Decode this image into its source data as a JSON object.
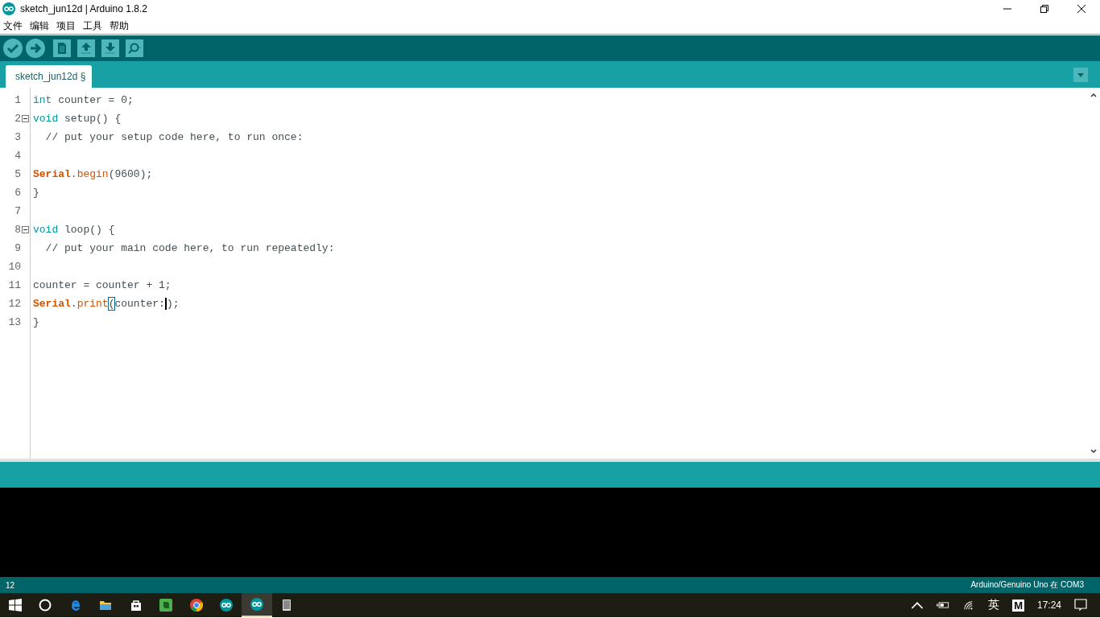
{
  "window": {
    "title": "sketch_jun12d | Arduino 1.8.2"
  },
  "menu": [
    "文件",
    "编辑",
    "项目",
    "工具",
    "帮助"
  ],
  "toolbar": [
    {
      "kind": "verify"
    },
    {
      "kind": "upload"
    },
    {
      "kind": "new"
    },
    {
      "kind": "open"
    },
    {
      "kind": "save"
    }
  ],
  "tabs": [
    {
      "label": "sketch_jun12d §",
      "selected": true
    }
  ],
  "editor": {
    "lines": [
      {
        "number": "1",
        "tokens": [
          {
            "kind": "type",
            "text": "int"
          },
          {
            "kind": "plain",
            "text": " counter = 0;"
          }
        ]
      },
      {
        "number": "2",
        "fold": true,
        "tokens": [
          {
            "kind": "type",
            "text": "void"
          },
          {
            "kind": "plain",
            "text": " setup() {"
          }
        ]
      },
      {
        "number": "3",
        "tokens": [
          {
            "kind": "comment",
            "text": "  // put your setup code here, to run once:"
          }
        ]
      },
      {
        "number": "4"
      },
      {
        "number": "5",
        "tokens": [
          {
            "kind": "class",
            "text": "Serial"
          },
          {
            "kind": "plain",
            "text": "."
          },
          {
            "kind": "func",
            "text": "begin"
          },
          {
            "kind": "plain",
            "text": "(9600);"
          }
        ]
      },
      {
        "number": "6",
        "tokens": [
          {
            "kind": "plain",
            "text": "}"
          }
        ]
      },
      {
        "number": "7"
      },
      {
        "number": "8",
        "fold": true,
        "tokens": [
          {
            "kind": "type",
            "text": "void"
          },
          {
            "kind": "plain",
            "text": " loop() {"
          }
        ]
      },
      {
        "number": "9",
        "tokens": [
          {
            "kind": "comment",
            "text": "  // put your main code here, to run repeatedly:"
          }
        ]
      },
      {
        "number": "10"
      },
      {
        "number": "11",
        "tokens": [
          {
            "kind": "plain",
            "text": "counter = counter + 1;"
          }
        ]
      },
      {
        "number": "12",
        "tokens": [
          {
            "kind": "class",
            "text": "Serial"
          },
          {
            "kind": "plain",
            "text": "."
          },
          {
            "kind": "func",
            "text": "print"
          },
          {
            "kind": "bracket",
            "text": "("
          },
          {
            "kind": "plain",
            "text": "counter:"
          },
          {
            "kind": "cursor",
            "text": ")"
          },
          {
            "kind": "plain",
            "text": ";"
          }
        ]
      },
      {
        "number": "13",
        "tokens": [
          {
            "kind": "plain",
            "text": "}"
          }
        ]
      }
    ]
  },
  "status_bar": {
    "line": "12",
    "board": "Arduino/Genuino Uno 在 COM3"
  },
  "taskbar": {
    "apps": [
      {
        "kind": "start",
        "selected": false
      },
      {
        "kind": "search",
        "selected": false
      },
      {
        "kind": "browser",
        "selected": false
      },
      {
        "kind": "folder",
        "selected": false
      },
      {
        "kind": "store",
        "selected": false
      },
      {
        "kind": "notes",
        "selected": false
      },
      {
        "kind": "chrome",
        "selected": false
      },
      {
        "kind": "arduino",
        "selected": false
      },
      {
        "kind": "arduino",
        "selected": true
      },
      {
        "kind": "tablet",
        "selected": false
      }
    ],
    "tray": {
      "ime": "英",
      "ime_mode": "M",
      "time": "17:24"
    }
  }
}
